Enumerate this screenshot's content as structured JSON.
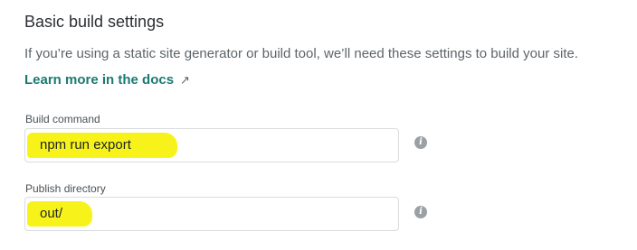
{
  "section": {
    "title": "Basic build settings",
    "description": "If you’re using a static site generator or build tool, we’ll need these settings to build your site.",
    "learn_more": "Learn more in the docs",
    "learn_more_arrow": "↗"
  },
  "fields": {
    "build_command": {
      "label": "Build command",
      "value": "npm run export",
      "info_glyph": "i"
    },
    "publish_directory": {
      "label": "Publish directory",
      "value": "out/",
      "info_glyph": "i"
    }
  },
  "colors": {
    "link": "#1a7a72",
    "highlight": "#f7f31a",
    "info_icon": "#9aa0a4"
  }
}
